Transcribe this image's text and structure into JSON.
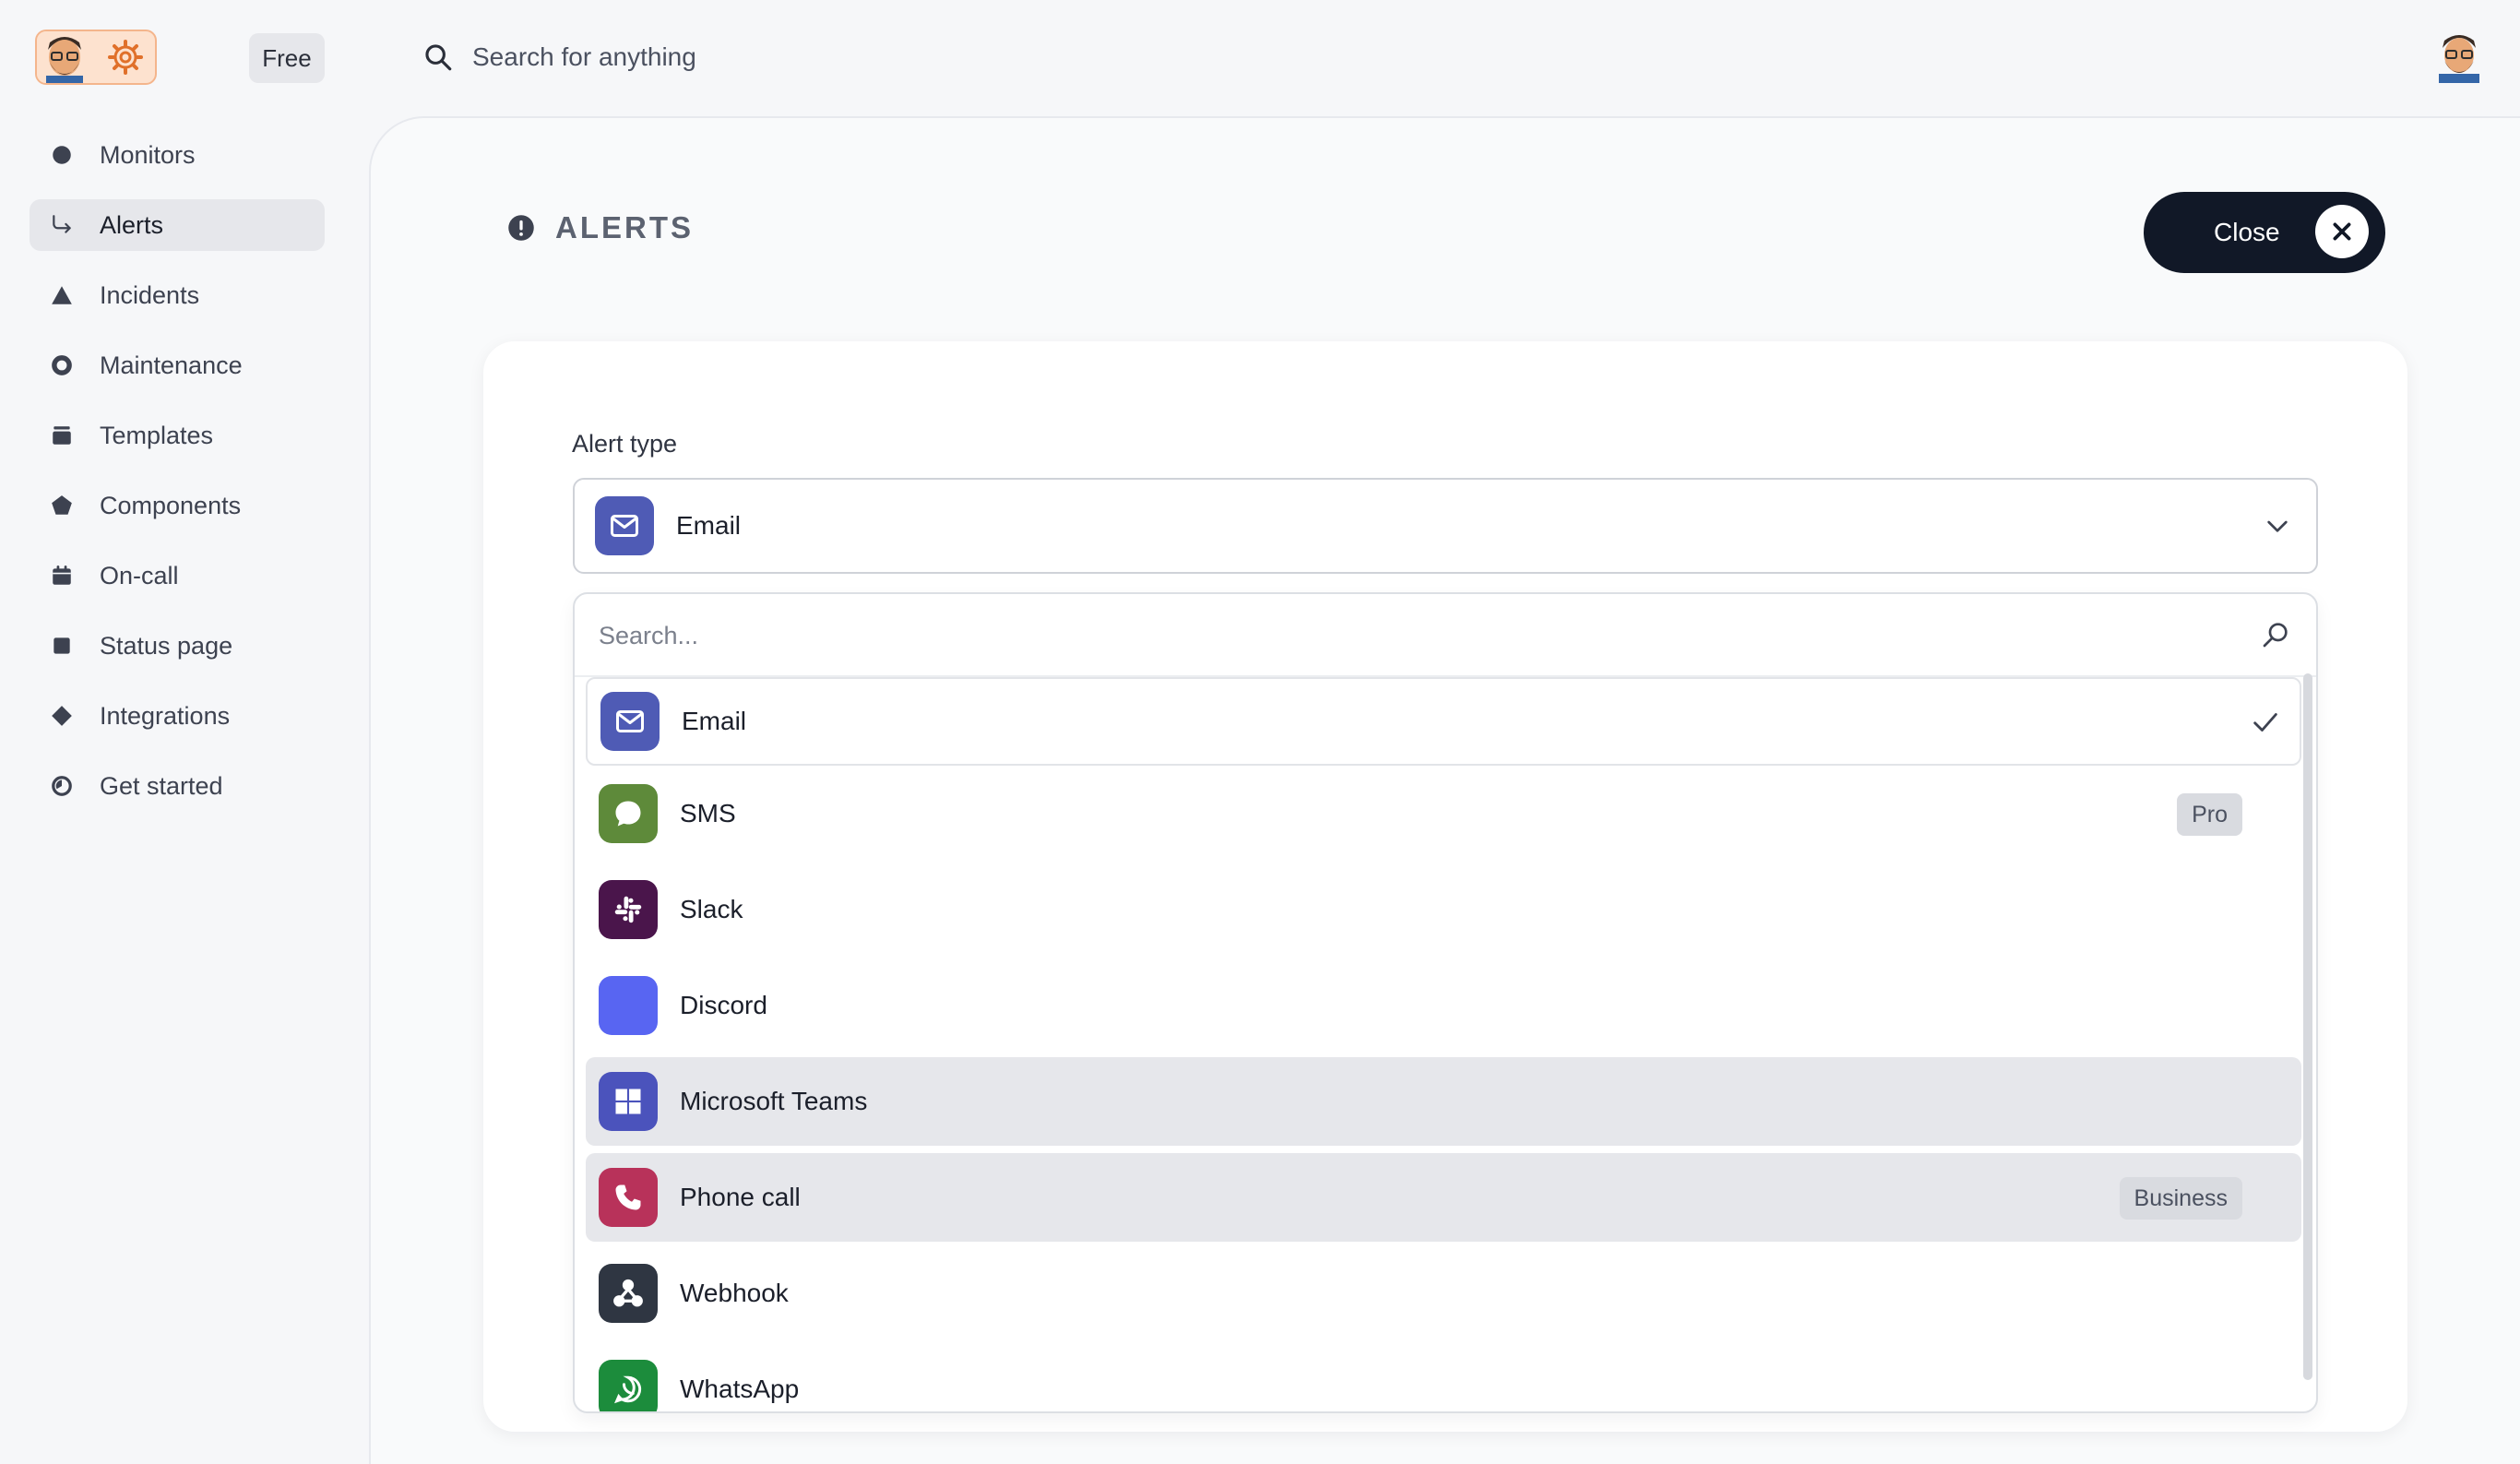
{
  "header": {
    "plan_badge": "Free",
    "search_placeholder": "Search for anything"
  },
  "sidebar": {
    "items": [
      {
        "label": "Monitors",
        "icon": "circle-icon"
      },
      {
        "label": "Alerts",
        "icon": "arrow-return-icon",
        "active": true
      },
      {
        "label": "Incidents",
        "icon": "triangle-icon"
      },
      {
        "label": "Maintenance",
        "icon": "ring-icon"
      },
      {
        "label": "Templates",
        "icon": "stack-icon"
      },
      {
        "label": "Components",
        "icon": "pentagon-icon"
      },
      {
        "label": "On-call",
        "icon": "calendar-icon"
      },
      {
        "label": "Status page",
        "icon": "square-icon"
      },
      {
        "label": "Integrations",
        "icon": "diamond-icon"
      },
      {
        "label": "Get started",
        "icon": "clock-icon"
      }
    ]
  },
  "page": {
    "title": "ALERTS",
    "close_label": "Close"
  },
  "form": {
    "alert_type_label": "Alert type",
    "selected_value": "Email",
    "dropdown_search_placeholder": "Search...",
    "options": [
      {
        "label": "Email",
        "color": "#4f5bb5",
        "icon": "email-icon",
        "selected": true,
        "tier": ""
      },
      {
        "label": "SMS",
        "color": "#5e8a3a",
        "icon": "chat-bubble-icon",
        "tier": "Pro"
      },
      {
        "label": "Slack",
        "color": "#4a154b",
        "icon": "slack-icon",
        "tier": ""
      },
      {
        "label": "Discord",
        "color": "#5865f2",
        "icon": "discord-icon",
        "tier": ""
      },
      {
        "label": "Microsoft Teams",
        "color": "#4b53bc",
        "icon": "grid-icon",
        "tier": "",
        "hover": true
      },
      {
        "label": "Phone call",
        "color": "#b8325a",
        "icon": "phone-icon",
        "tier": "Business",
        "hover": true
      },
      {
        "label": "Webhook",
        "color": "#2f3642",
        "icon": "webhook-icon",
        "tier": ""
      },
      {
        "label": "WhatsApp",
        "color": "#1c8c3c",
        "icon": "whatsapp-icon",
        "tier": ""
      }
    ]
  }
}
